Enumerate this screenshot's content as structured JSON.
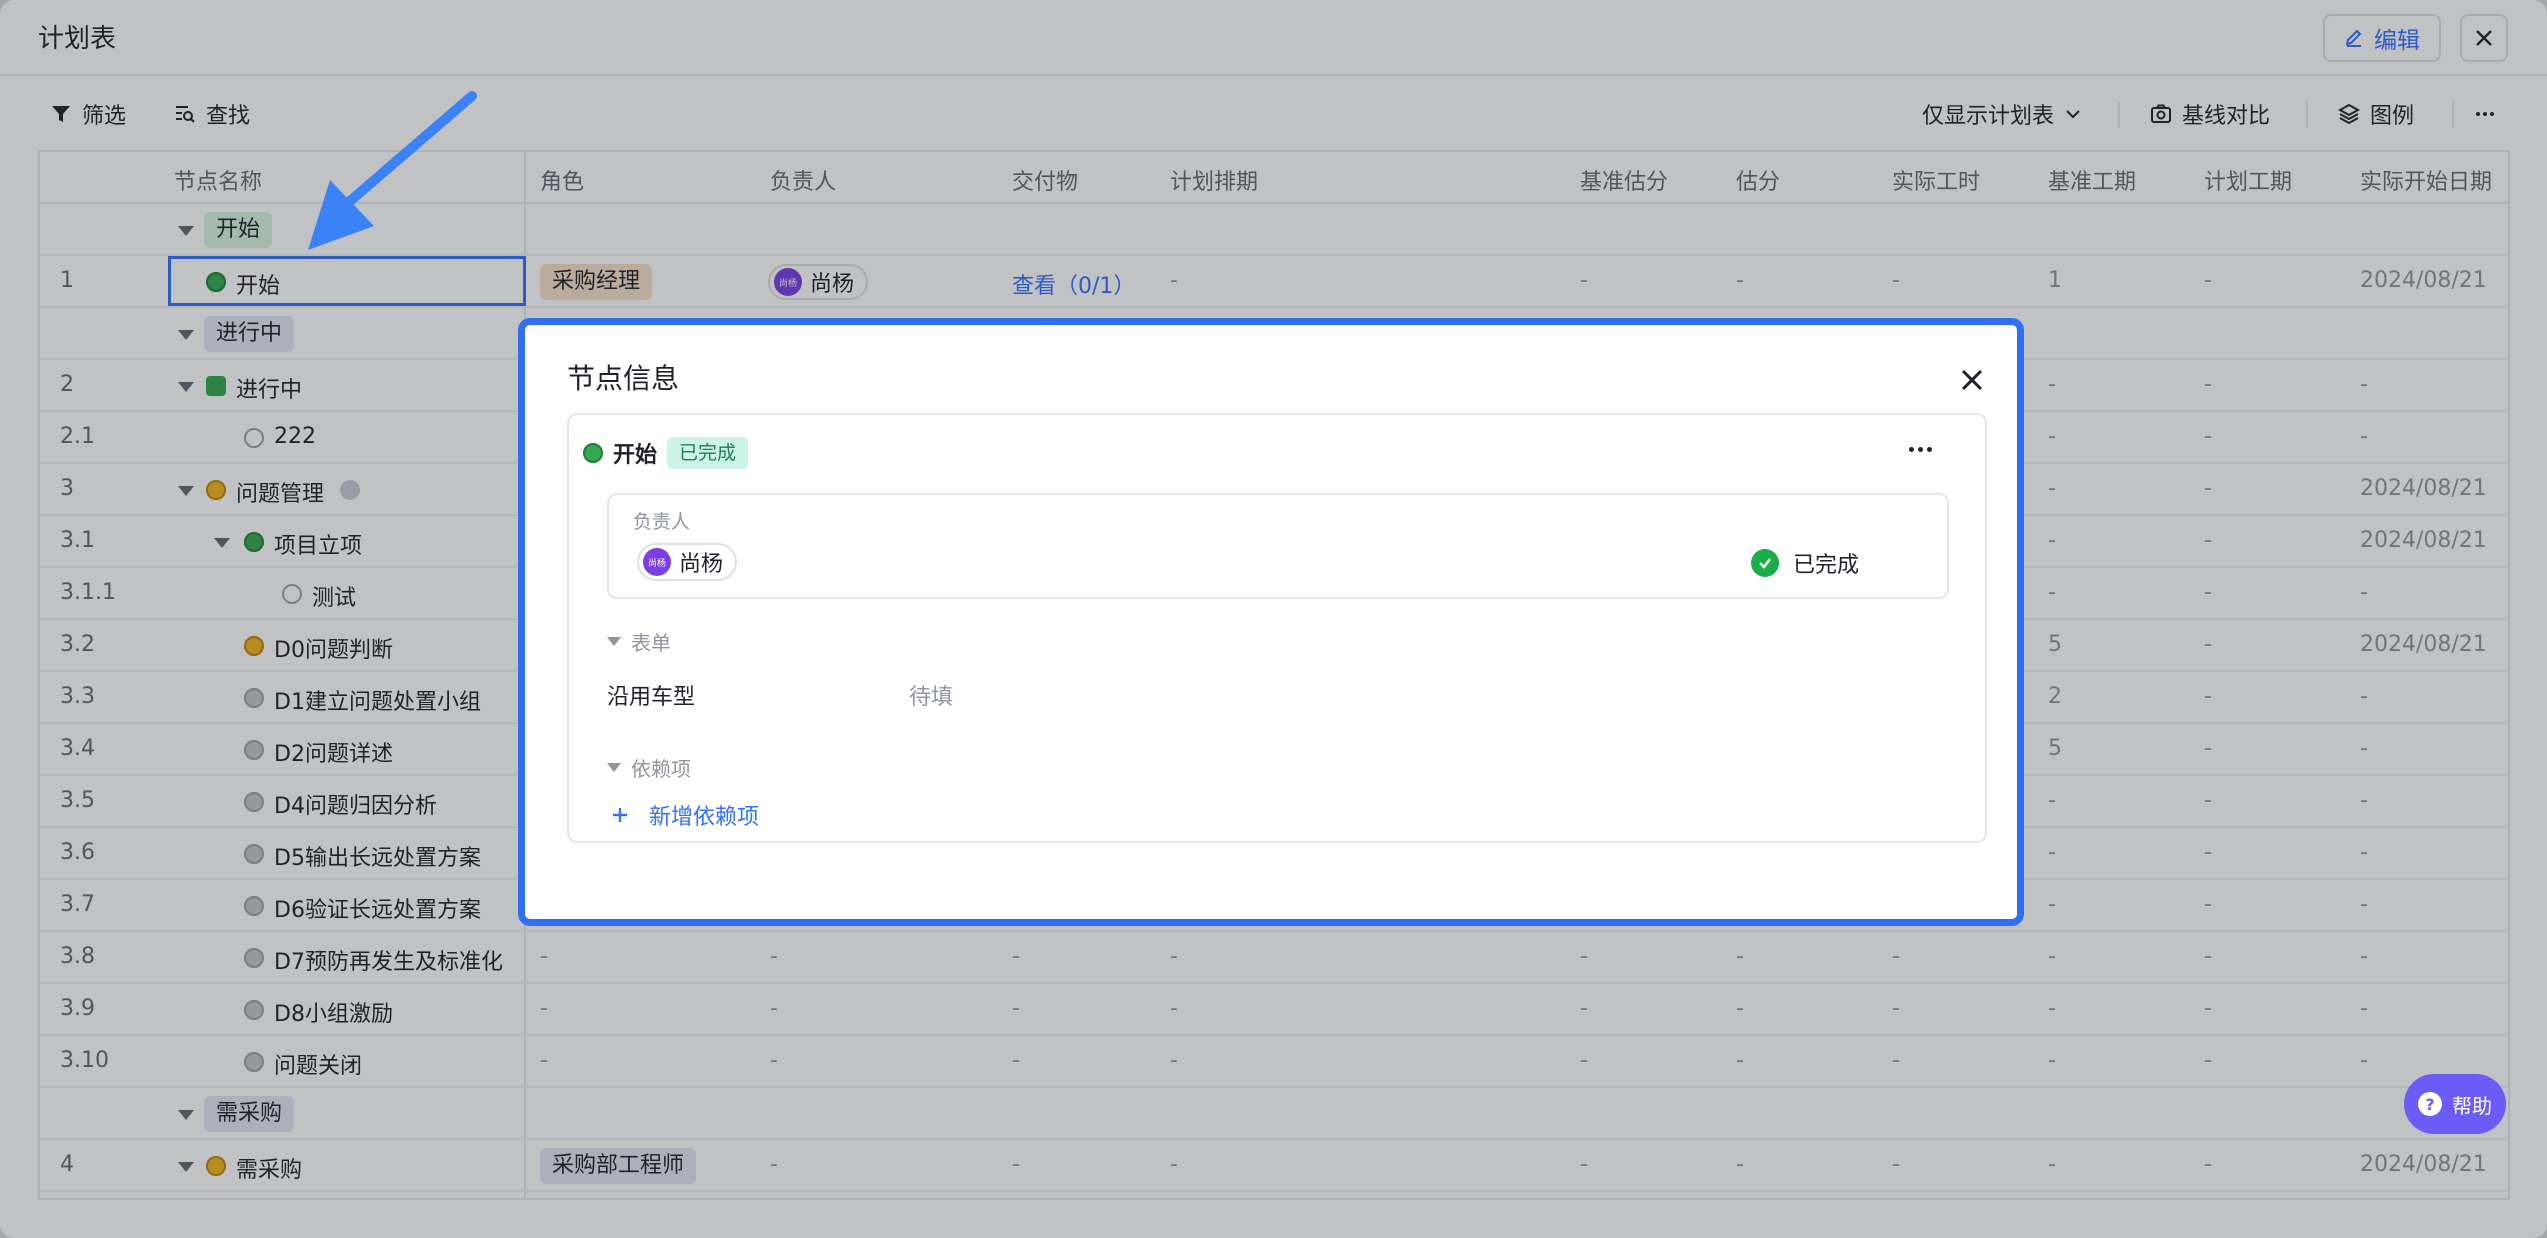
{
  "window": {
    "title": "计划表",
    "edit_label": "编辑"
  },
  "toolbar": {
    "filter_label": "筛选",
    "find_label": "查找",
    "view_select": "仅显示计划表",
    "baseline_label": "基线对比",
    "legend_label": "图例"
  },
  "table": {
    "columns": [
      "节点名称",
      "角色",
      "负责人",
      "交付物",
      "计划排期",
      "基准估分",
      "估分",
      "实际工时",
      "基准工期",
      "计划工期",
      "实际开始日期"
    ],
    "rows": [
      {
        "num": "",
        "name": "开始",
        "kind": "group"
      },
      {
        "num": "1",
        "name": "开始",
        "role": "采购经理",
        "owner": "尚杨",
        "owner_avatar": "尚杨",
        "deliverable": "查看（0/1）",
        "schedule": "-",
        "base_est": "-",
        "est": "-",
        "actual_hours": "-",
        "base_dur": "1",
        "plan_dur": "-",
        "actual_start": "2024/08/21"
      },
      {
        "num": "",
        "name": "进行中",
        "kind": "group"
      },
      {
        "num": "2",
        "name": "进行中",
        "base_dur": "-",
        "plan_dur": "-",
        "actual_start": "-"
      },
      {
        "num": "2.1",
        "name": "222",
        "base_dur": "-",
        "plan_dur": "-",
        "actual_start": "-"
      },
      {
        "num": "3",
        "name": "问题管理",
        "base_dur": "-",
        "plan_dur": "-",
        "actual_start": "2024/08/21"
      },
      {
        "num": "3.1",
        "name": "项目立项",
        "base_dur": "-",
        "plan_dur": "-",
        "actual_start": "2024/08/21"
      },
      {
        "num": "3.1.1",
        "name": "测试",
        "base_dur": "-",
        "plan_dur": "-",
        "actual_start": "-"
      },
      {
        "num": "3.2",
        "name": "D0问题判断",
        "base_dur": "5",
        "plan_dur": "-",
        "actual_start": "2024/08/21"
      },
      {
        "num": "3.3",
        "name": "D1建立问题处置小组",
        "base_dur": "2",
        "plan_dur": "-",
        "actual_start": "-"
      },
      {
        "num": "3.4",
        "name": "D2问题详述",
        "base_dur": "5",
        "plan_dur": "-",
        "actual_start": "-"
      },
      {
        "num": "3.5",
        "name": "D4问题归因分析",
        "base_dur": "-",
        "plan_dur": "-",
        "actual_start": "-"
      },
      {
        "num": "3.6",
        "name": "D5输出长远处置方案",
        "base_dur": "-",
        "plan_dur": "-",
        "actual_start": "-"
      },
      {
        "num": "3.7",
        "name": "D6验证长远处置方案",
        "base_dur": "-",
        "plan_dur": "-",
        "actual_start": "-"
      },
      {
        "num": "3.8",
        "name": "D7预防再发生及标准化",
        "role": "-",
        "owner": "-",
        "deliverable": "-",
        "schedule": "-",
        "base_est": "-",
        "est": "-",
        "actual_hours": "-",
        "base_dur": "-",
        "plan_dur": "-",
        "actual_start": "-"
      },
      {
        "num": "3.9",
        "name": "D8小组激励",
        "role": "-",
        "owner": "-",
        "deliverable": "-",
        "schedule": "-",
        "base_est": "-",
        "est": "-",
        "actual_hours": "-",
        "base_dur": "-",
        "plan_dur": "-",
        "actual_start": "-"
      },
      {
        "num": "3.10",
        "name": "问题关闭",
        "role": "-",
        "owner": "-",
        "deliverable": "-",
        "schedule": "-",
        "base_est": "-",
        "est": "-",
        "actual_hours": "-",
        "base_dur": "-",
        "plan_dur": "-",
        "actual_start": "-"
      },
      {
        "num": "",
        "name": "需采购",
        "kind": "group"
      },
      {
        "num": "4",
        "name": "需采购",
        "role": "采购部工程师",
        "owner": "-",
        "deliverable": "-",
        "schedule": "-",
        "base_est": "-",
        "est": "-",
        "actual_hours": "-",
        "base_dur": "-",
        "plan_dur": "-",
        "actual_start": "2024/08/21"
      }
    ]
  },
  "modal": {
    "title": "节点信息",
    "node_name": "开始",
    "node_status": "已完成",
    "owner_label": "负责人",
    "owner_name": "尚杨",
    "owner_avatar": "尚杨",
    "owner_status": "已完成",
    "form_section": "表单",
    "form_key": "沿用车型",
    "form_value": "待填",
    "deps_section": "依赖项",
    "add_dep_label": "新增依赖项"
  },
  "help": {
    "label": "帮助",
    "icon": "?"
  },
  "colors": {
    "accent": "#3370ff",
    "modal_border": "#2f6ff0",
    "help": "#6a5cf5",
    "status_green": "#1aae4a"
  }
}
